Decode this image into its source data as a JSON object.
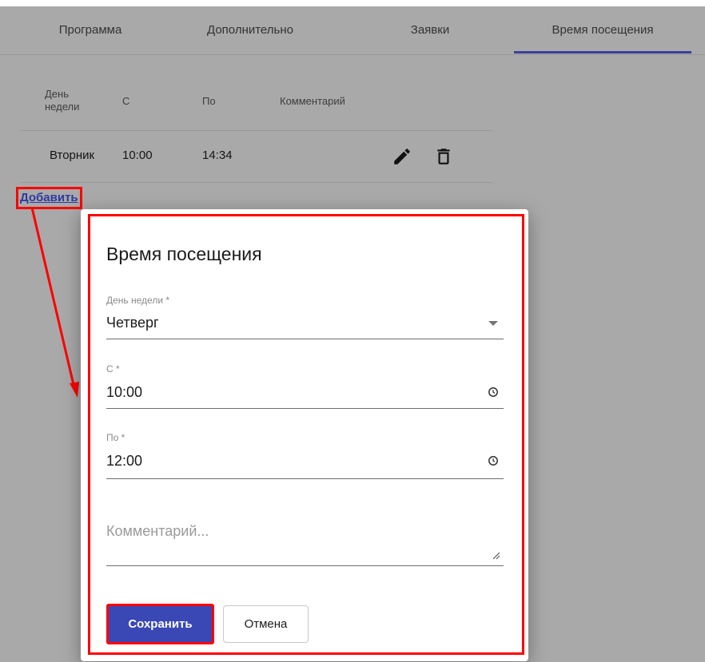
{
  "tabs": [
    {
      "label": "Программа"
    },
    {
      "label": "Дополнительно"
    },
    {
      "label": "Заявки"
    },
    {
      "label": "Время посещения"
    }
  ],
  "table": {
    "headers": {
      "day": "День\nнедели",
      "from": "С",
      "to": "По",
      "comment": "Комментарий"
    },
    "rows": [
      {
        "day": "Вторник",
        "from": "10:00",
        "to": "14:34",
        "comment": ""
      }
    ]
  },
  "add_label": "Добавить",
  "dialog": {
    "title": "Время посещения",
    "day_label": "День недели *",
    "day_value": "Четверг",
    "from_label": "С *",
    "from_value": "10:00",
    "to_label": "По *",
    "to_value": "12:00",
    "comment_placeholder": "Комментарий...",
    "save_label": "Сохранить",
    "cancel_label": "Отмена"
  },
  "colors": {
    "accent": "#3a48b5",
    "annotation": "#ff0000",
    "tab_underline": "#3a3f99"
  },
  "icons": [
    "pencil-icon",
    "trash-icon",
    "chevron-down-icon",
    "clock-icon",
    "resize-handle-icon"
  ]
}
